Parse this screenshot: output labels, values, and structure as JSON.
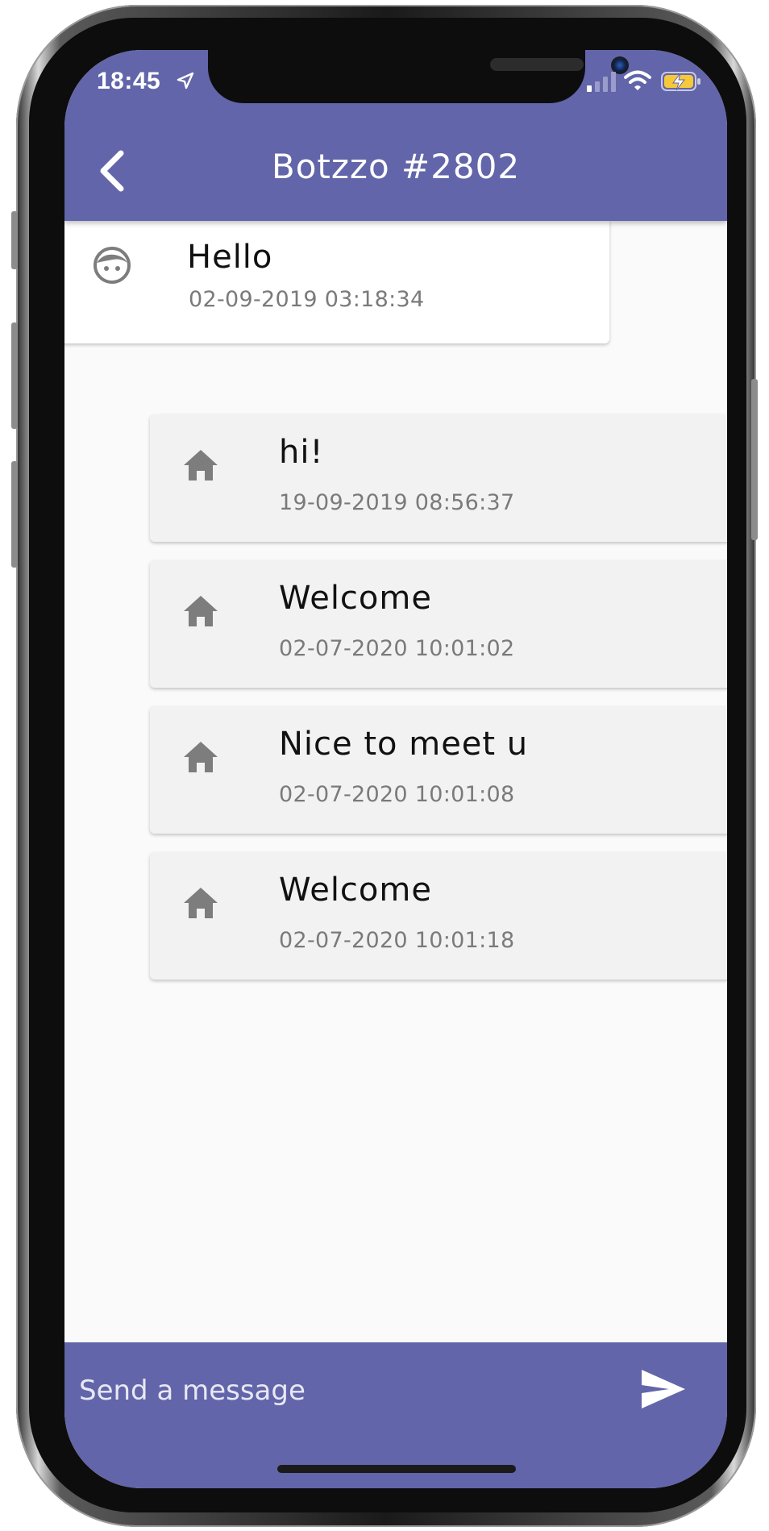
{
  "status_bar": {
    "time": "18:45",
    "location_icon": "location-arrow-icon",
    "signal_icon": "cellular-signal-icon",
    "wifi_icon": "wifi-icon",
    "battery_icon": "battery-charging-icon"
  },
  "header": {
    "title": "Botzzo #2802",
    "back_icon": "chevron-left-icon",
    "background_color": "#6265a9"
  },
  "messages": [
    {
      "sender": "user",
      "icon": "face-icon",
      "text": "Hello",
      "timestamp": "02-09-2019 03:18:34"
    },
    {
      "sender": "bot",
      "icon": "home-icon",
      "text": "hi!",
      "timestamp": "19-09-2019 08:56:37"
    },
    {
      "sender": "bot",
      "icon": "home-icon",
      "text": "Welcome",
      "timestamp": "02-07-2020 10:01:02"
    },
    {
      "sender": "bot",
      "icon": "home-icon",
      "text": "Nice to meet u",
      "timestamp": "02-07-2020 10:01:08"
    },
    {
      "sender": "bot",
      "icon": "home-icon",
      "text": "Welcome",
      "timestamp": "02-07-2020 10:01:18"
    }
  ],
  "composer": {
    "placeholder": "Send a message",
    "value": "",
    "send_icon": "send-icon"
  },
  "colors": {
    "accent": "#6265a9",
    "outgoing_bubble": "#ffffff",
    "incoming_bubble": "#f2f2f2",
    "icon_gray": "#7d7d7d",
    "timestamp_gray": "#7a7a7a"
  }
}
